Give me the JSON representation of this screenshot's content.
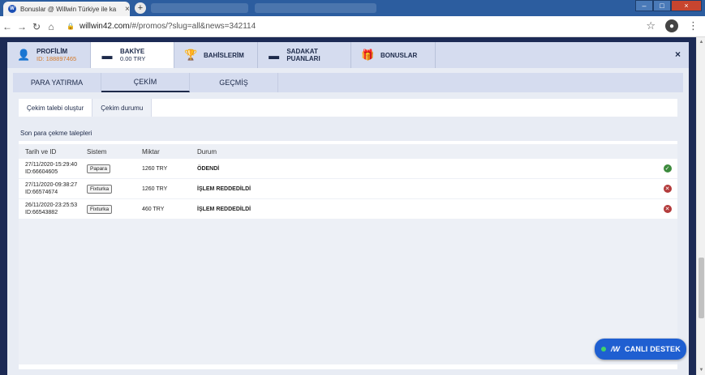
{
  "browser": {
    "tab_title": "Bonuslar @ Willwin Türkiye ile ka",
    "tab_close": "×",
    "new_tab": "+",
    "url": "willwin42.com/#/promos/?slug=all&news=342114",
    "url_host": "willwin42.com",
    "url_path": "/#/promos/?slug=all&news=342114",
    "win_min": "–",
    "win_max": "□",
    "win_close": "×"
  },
  "mainnav": {
    "profile_label": "PROFİLİM",
    "profile_id": "ID: 188897465",
    "balance_label": "BAKİYE",
    "balance_value": "0.00 TRY",
    "bets_label": "BAHİSLERİM",
    "loyalty_label": "SADAKAT PUANLARI",
    "bonus_label": "BONUSLAR",
    "close": "×"
  },
  "subtabs": [
    "PARA YATIRMA",
    "ÇEKİM",
    "GEÇMİŞ"
  ],
  "innertabs": [
    "Çekim talebi oluştur",
    "Çekim durumu"
  ],
  "section_title": "Son para çekme talepleri",
  "table": {
    "headers": [
      "Tarih ve ID",
      "Sistem",
      "Miktar",
      "Durum"
    ],
    "rows": [
      {
        "date": "27/11/2020-15:29:40",
        "id": "ID:66604605",
        "system": "Papara",
        "amount": "1260 TRY",
        "status": "ÖDENDİ",
        "icon": "check-icon"
      },
      {
        "date": "27/11/2020-09:38:27",
        "id": "ID:66574674",
        "system": "Fixturka",
        "amount": "1260 TRY",
        "status": "İŞLEM REDDEDİLDİ",
        "icon": "x-icon"
      },
      {
        "date": "26/11/2020-23:25:53",
        "id": "ID:66543882",
        "system": "Fixturka",
        "amount": "460 TRY",
        "status": "İŞLEM REDDEDİLDİ",
        "icon": "x-icon"
      }
    ]
  },
  "livechat": {
    "logo": "/W",
    "label": "CANLI DESTEK"
  },
  "colors": {
    "accent": "#1d2a4a",
    "chat": "#1f5fd1",
    "ok": "#3c8a3c",
    "rejected": "#b23a3a"
  }
}
